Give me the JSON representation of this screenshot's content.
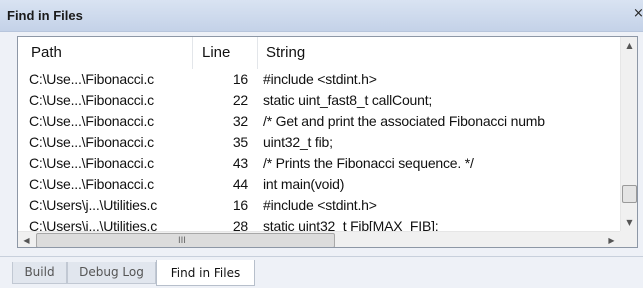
{
  "window": {
    "title": "Find in Files",
    "close_glyph": "×"
  },
  "columns": {
    "path": "Path",
    "line": "Line",
    "string": "String"
  },
  "rows": [
    {
      "path": "C:\\Use...\\Fibonacci.c",
      "line": "16",
      "string": "#include <stdint.h>"
    },
    {
      "path": "C:\\Use...\\Fibonacci.c",
      "line": "22",
      "string": "static uint_fast8_t callCount;"
    },
    {
      "path": "C:\\Use...\\Fibonacci.c",
      "line": "32",
      "string": "/* Get and print the associated Fibonacci numb"
    },
    {
      "path": "C:\\Use...\\Fibonacci.c",
      "line": "35",
      "string": "uint32_t fib;"
    },
    {
      "path": "C:\\Use...\\Fibonacci.c",
      "line": "43",
      "string": "/* Prints the Fibonacci sequence. */"
    },
    {
      "path": "C:\\Use...\\Fibonacci.c",
      "line": "44",
      "string": "int main(void)"
    },
    {
      "path": "C:\\Users\\j...\\Utilities.c",
      "line": "16",
      "string": "#include <stdint.h>"
    },
    {
      "path": "C:\\Users\\j...\\Utilities.c",
      "line": "28",
      "string": "static uint32_t Fib[MAX_FIB];"
    }
  ],
  "scrollbars": {
    "up_glyph": "▲",
    "down_glyph": "▼",
    "left_glyph": "◀",
    "right_glyph": "▶",
    "grip_glyph": "III"
  },
  "tabs": [
    {
      "label": "Build"
    },
    {
      "label": "Debug Log"
    },
    {
      "label": "Find in Files",
      "active": true
    }
  ]
}
